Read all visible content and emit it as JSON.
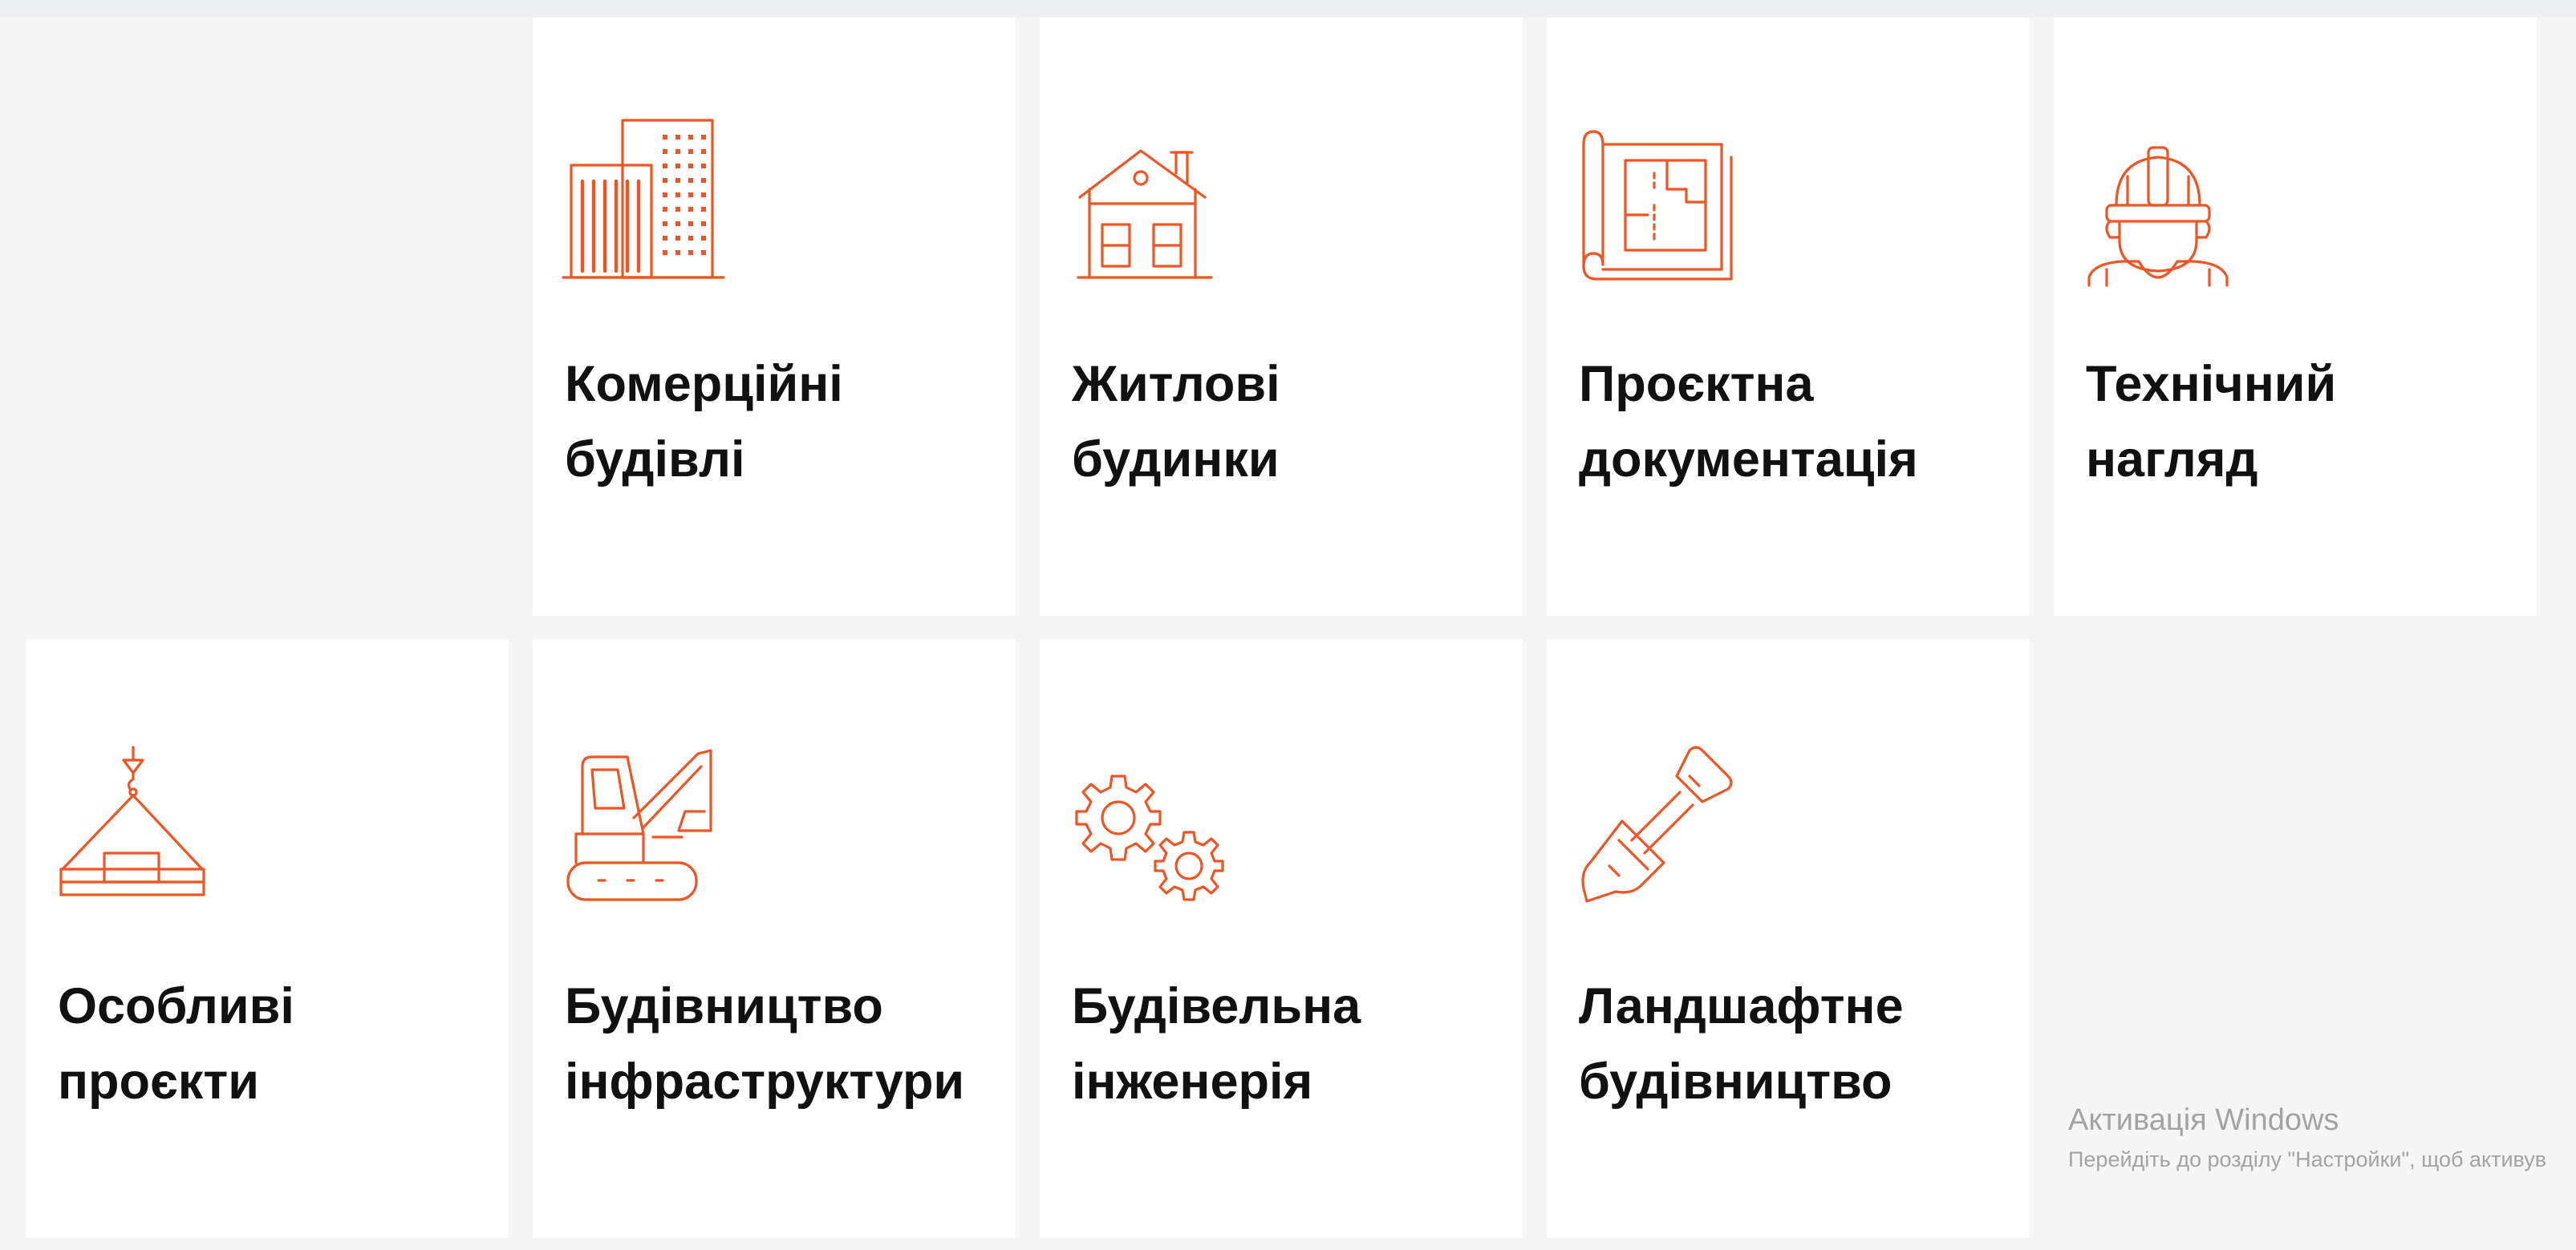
{
  "accent_color": "#ee5524",
  "cards": [
    {
      "icon": "office-buildings-icon",
      "line1": "Комерційні",
      "line2": "будівлі"
    },
    {
      "icon": "house-icon",
      "line1": "Житлові",
      "line2": "будинки"
    },
    {
      "icon": "blueprint-icon",
      "line1": "Проєктна",
      "line2": "документація"
    },
    {
      "icon": "engineer-hardhat-icon",
      "line1": "Технічний",
      "line2": "нагляд"
    },
    {
      "icon": "crane-load-icon",
      "line1": "Особливі",
      "line2": "проєкти"
    },
    {
      "icon": "excavator-icon",
      "line1": "Будівництво",
      "line2": "інфраструктури"
    },
    {
      "icon": "gears-icon",
      "line1": "Будівельна",
      "line2": "інженерія"
    },
    {
      "icon": "shovel-icon",
      "line1": "Ландшафтне",
      "line2": "будівництво"
    }
  ],
  "watermark": {
    "title": "Активація Windows",
    "subtitle": "Перейдіть до розділу \"Настройки\", щоб активув"
  }
}
